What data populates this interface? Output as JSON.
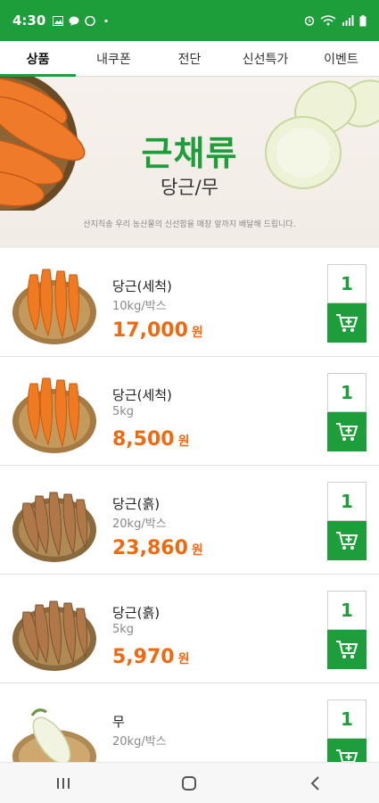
{
  "status_bar": {
    "time": "4:30"
  },
  "tabs": [
    {
      "label": "상품"
    },
    {
      "label": "내쿠폰"
    },
    {
      "label": "전단"
    },
    {
      "label": "신선특가"
    },
    {
      "label": "이벤트"
    }
  ],
  "banner": {
    "title": "근채류",
    "subtitle": "당근/무",
    "description": "산지직송 우리 농산물의 신선함을 매장 앞까지 배달해 드립니다."
  },
  "products": [
    {
      "name": "당근(세척)",
      "spec": "10kg/박스",
      "price": "17,000",
      "unit": "원",
      "qty": "1",
      "image": "washed-carrot-basket"
    },
    {
      "name": "당근(세척)",
      "spec": "5kg",
      "price": "8,500",
      "unit": "원",
      "qty": "1",
      "image": "washed-carrot-basket"
    },
    {
      "name": "당근(흙)",
      "spec": "20kg/박스",
      "price": "23,860",
      "unit": "원",
      "qty": "1",
      "image": "soil-carrot-basket"
    },
    {
      "name": "당근(흙)",
      "spec": "5kg",
      "price": "5,970",
      "unit": "원",
      "qty": "1",
      "image": "soil-carrot-basket"
    },
    {
      "name": "무",
      "spec": "20kg/박스",
      "price": "",
      "unit": "",
      "qty": "1",
      "image": "radish-basket"
    }
  ],
  "colors": {
    "brand_green": "#1e9e3a",
    "price_orange": "#ee6a12"
  },
  "icons": {
    "cart": "cart-add-icon",
    "nav_recent": "recent-apps-icon",
    "nav_home": "home-icon",
    "nav_back": "back-icon"
  }
}
